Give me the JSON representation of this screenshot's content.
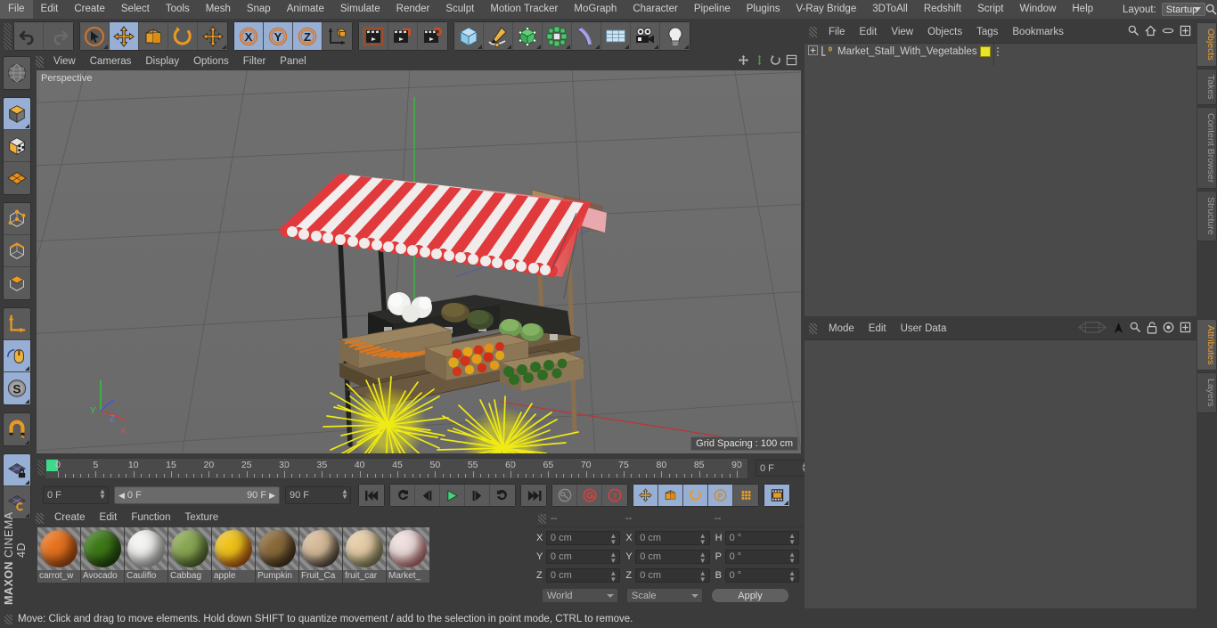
{
  "app": {
    "brand_top": "MAXON",
    "brand_bottom": "CINEMA 4D"
  },
  "menubar": {
    "items": [
      "File",
      "Edit",
      "Create",
      "Select",
      "Tools",
      "Mesh",
      "Snap",
      "Animate",
      "Simulate",
      "Render",
      "Sculpt",
      "Motion Tracker",
      "MoGraph",
      "Character",
      "Pipeline",
      "Plugins",
      "V-Ray Bridge",
      "3DToAll",
      "Redshift",
      "Script",
      "Window",
      "Help"
    ],
    "layout_label": "Layout:",
    "layout_value": "Startup",
    "search_icon": "search-icon"
  },
  "toolbar": {
    "groups": [
      {
        "name": "history",
        "buttons": [
          {
            "icon": "undo-icon",
            "active": false
          },
          {
            "icon": "redo-icon",
            "active": false
          }
        ]
      },
      {
        "name": "transform",
        "buttons": [
          {
            "icon": "select-cursor-icon",
            "active": false
          },
          {
            "icon": "move-icon",
            "active": true
          },
          {
            "icon": "scale-icon",
            "active": false
          },
          {
            "icon": "rotate-icon",
            "active": false
          },
          {
            "icon": "move-dynamic-icon",
            "active": false
          }
        ]
      },
      {
        "name": "axis-lock",
        "buttons": [
          {
            "icon": "axis-x-icon",
            "active": true
          },
          {
            "icon": "axis-y-icon",
            "active": true
          },
          {
            "icon": "axis-z-icon",
            "active": true
          },
          {
            "icon": "world-object-axis-icon",
            "active": false
          }
        ]
      },
      {
        "name": "render",
        "buttons": [
          {
            "icon": "render-view-icon",
            "active": false
          },
          {
            "icon": "render-picture-viewer-icon",
            "active": false
          },
          {
            "icon": "render-settings-icon",
            "active": false
          }
        ]
      },
      {
        "name": "create",
        "buttons": [
          {
            "icon": "cube-primitive-icon",
            "active": false
          },
          {
            "icon": "spline-pen-icon",
            "active": false
          },
          {
            "icon": "generator-nurbs-icon",
            "active": false
          },
          {
            "icon": "mograph-cloner-icon",
            "active": false
          },
          {
            "icon": "deformer-bend-icon",
            "active": false
          },
          {
            "icon": "scene-floor-icon",
            "active": false
          },
          {
            "icon": "camera-icon",
            "active": false
          },
          {
            "icon": "light-icon",
            "active": false
          }
        ]
      }
    ]
  },
  "left_toolbar": {
    "groups": [
      {
        "buttons": [
          {
            "icon": "viewport-globe-icon",
            "active": false
          }
        ]
      },
      {
        "buttons": [
          {
            "icon": "model-mode-icon",
            "active": true
          },
          {
            "icon": "texture-mode-icon",
            "active": false
          },
          {
            "icon": "workplane-mode-icon",
            "active": false
          }
        ]
      },
      {
        "buttons": [
          {
            "icon": "point-mode-icon",
            "active": false
          },
          {
            "icon": "edge-mode-icon",
            "active": false
          },
          {
            "icon": "polygon-mode-icon",
            "active": false
          }
        ]
      },
      {
        "buttons": [
          {
            "icon": "object-axis-icon",
            "active": false
          },
          {
            "icon": "viewport-solo-mouse-icon",
            "active": true
          },
          {
            "icon": "soft-selection-icon",
            "active": true
          }
        ]
      },
      {
        "buttons": [
          {
            "icon": "magnet-icon",
            "active": false
          }
        ]
      },
      {
        "buttons": [
          {
            "icon": "workplane-lock-icon",
            "active": true
          },
          {
            "icon": "workplane-rotate-icon",
            "active": false
          }
        ]
      }
    ]
  },
  "viewport": {
    "menu": [
      "View",
      "Cameras",
      "Display",
      "Options",
      "Filter",
      "Panel"
    ],
    "camera_label": "Perspective",
    "grid_spacing": "Grid Spacing : 100 cm",
    "axis_gizmo": {
      "x": "X",
      "y": "Y",
      "z": "Z"
    },
    "nav_icons": [
      "pan-icon",
      "zoom-icon",
      "rotate-icon",
      "maximize-icon"
    ],
    "scene": {
      "object": "Market stall with striped awning and vegetable crates",
      "awning_color_a": "#e03a3c",
      "awning_color_b": "#f0eceb",
      "selection_highlight_color": "#f5f011",
      "background_color": "#6d6d6d"
    }
  },
  "timeline": {
    "ruler_labels": [
      "0",
      "5",
      "10",
      "15",
      "20",
      "25",
      "30",
      "35",
      "40",
      "45",
      "50",
      "55",
      "60",
      "65",
      "70",
      "75",
      "80",
      "85",
      "90"
    ],
    "current_frame_field": "0 F",
    "start_frame": "0 F",
    "preview_min": "0 F",
    "preview_max": "90 F",
    "end_frame": "90 F",
    "transport": [
      {
        "icon": "go-to-start-icon"
      },
      {
        "icon": "previous-key-icon"
      },
      {
        "icon": "step-back-icon"
      },
      {
        "icon": "play-icon"
      },
      {
        "icon": "step-forward-icon"
      },
      {
        "icon": "next-key-icon"
      },
      {
        "icon": "go-to-end-icon"
      }
    ],
    "key_buttons": [
      {
        "icon": "autokey-icon"
      },
      {
        "icon": "record-key-icon"
      },
      {
        "icon": "key-selection-icon"
      }
    ],
    "key_channels": [
      {
        "icon": "key-position-icon",
        "active": true
      },
      {
        "icon": "key-scale-icon",
        "active": true
      },
      {
        "icon": "key-rotation-icon",
        "active": true
      },
      {
        "icon": "key-parameter-icon",
        "active": true
      },
      {
        "icon": "key-pla-icon",
        "active": false
      },
      {
        "icon": "keyframe-mode-icon",
        "active": true
      }
    ]
  },
  "material_manager": {
    "menu": [
      "Create",
      "Edit",
      "Function",
      "Texture"
    ],
    "materials": [
      {
        "name": "carrot_w",
        "color_a": "#e8731f",
        "color_b": "#b74d10"
      },
      {
        "name": "Avocado",
        "color_a": "#3d7a18",
        "color_b": "#1d3c07"
      },
      {
        "name": "Cauliflo",
        "color_a": "#f4f4f2",
        "color_b": "#c3c3c0"
      },
      {
        "name": "Cabbag",
        "color_a": "#8aa853",
        "color_b": "#4a6328"
      },
      {
        "name": "apple",
        "color_a": "#f0c21b",
        "color_b": "#d42f17"
      },
      {
        "name": "Pumpkin",
        "color_a": "#8a6a3b",
        "color_b": "#2c2014"
      },
      {
        "name": "Fruit_Ca",
        "color_a": "#d6bb99",
        "color_b": "#1a1715"
      },
      {
        "name": "fruit_car",
        "color_a": "#e5cda6",
        "color_b": "#6c7a3a"
      },
      {
        "name": "Market_",
        "color_a": "#f0dede",
        "color_b": "#d8484c"
      }
    ]
  },
  "coordinates": {
    "headers": [
      "--",
      "--",
      "--"
    ],
    "rows": [
      {
        "pos_label": "X",
        "pos_value": "0 cm",
        "size_label": "X",
        "size_value": "0 cm",
        "rot_label": "H",
        "rot_value": "0 °"
      },
      {
        "pos_label": "Y",
        "pos_value": "0 cm",
        "size_label": "Y",
        "size_value": "0 cm",
        "rot_label": "P",
        "rot_value": "0 °"
      },
      {
        "pos_label": "Z",
        "pos_value": "0 cm",
        "size_label": "Z",
        "size_value": "0 cm",
        "rot_label": "B",
        "rot_value": "0 °"
      }
    ],
    "system_value": "World",
    "mode_value": "Scale",
    "apply_label": "Apply"
  },
  "object_manager": {
    "menu": [
      "File",
      "Edit",
      "View",
      "Objects",
      "Tags",
      "Bookmarks"
    ],
    "icons": [
      "search-icon",
      "home-icon",
      "eye-icon",
      "maximize-icon"
    ],
    "rows": [
      {
        "name": "Market_Stall_With_Vegetables",
        "layer_color": "#e9e52c",
        "level_badge": "0"
      }
    ]
  },
  "attribute_manager": {
    "menu": [
      "Mode",
      "Edit",
      "User Data"
    ],
    "icons": [
      "interaction-icon",
      "pin-icon",
      "search-icon",
      "lock-icon",
      "target-icon",
      "maximize-icon"
    ]
  },
  "right_tabs_top": [
    {
      "label": "Objects",
      "selected": true
    },
    {
      "label": "Takes",
      "selected": false
    },
    {
      "label": "Content Browser",
      "selected": false
    },
    {
      "label": "Structure",
      "selected": false
    }
  ],
  "right_tabs_bottom": [
    {
      "label": "Attributes",
      "selected": true
    },
    {
      "label": "Layers",
      "selected": false
    }
  ],
  "status_bar": {
    "message": "Move: Click and drag to move elements. Hold down SHIFT to quantize movement / add to the selection in point mode, CTRL to remove."
  }
}
